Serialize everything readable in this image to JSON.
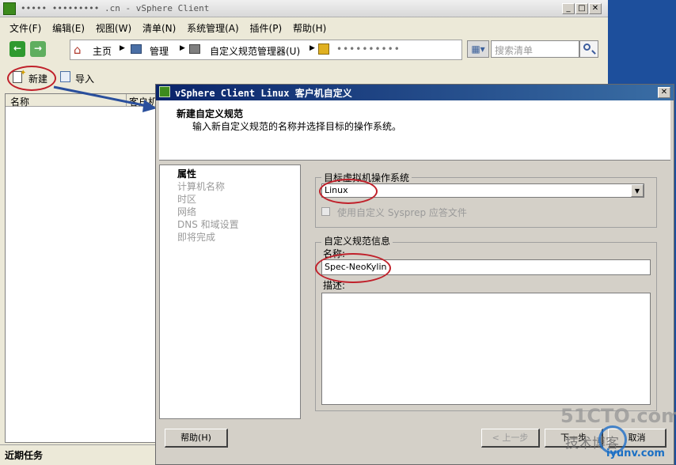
{
  "main_window": {
    "title": "••••• ••••••••• .cn - vSphere Client",
    "menu": [
      "文件(F)",
      "编辑(E)",
      "视图(W)",
      "清单(N)",
      "系统管理(A)",
      "插件(P)",
      "帮助(H)"
    ],
    "breadcrumb": {
      "home": "主页",
      "admin": "管理",
      "spec_manager": "自定义规范管理器(U)",
      "host": "••••••••••"
    },
    "search_placeholder": "搜索清单",
    "toolbar": {
      "new_label": "新建",
      "import_label": "导入"
    },
    "columns": [
      "名称",
      "客户机"
    ],
    "recent_tasks": "近期任务"
  },
  "dialog": {
    "title": "vSphere Client Linux 客户机自定义",
    "header_title": "新建自定义规范",
    "header_subtitle": "输入新自定义规范的名称并选择目标的操作系统。",
    "steps": [
      "属性",
      "计算机名称",
      "时区",
      "网络",
      "DNS 和域设置",
      "即将完成"
    ],
    "os_group_label": "目标虚拟机操作系统",
    "os_value": "Linux",
    "sysprep_label": "使用自定义 Sysprep 应答文件",
    "info_group_label": "自定义规范信息",
    "name_label": "名称:",
    "name_value": "Spec-NeoKylin",
    "desc_label": "描述:",
    "buttons": {
      "help": "帮助(H)",
      "back": "< 上一步",
      "next": "下一步",
      "cancel": "取消"
    }
  },
  "watermark": {
    "site": "51CTO.com",
    "tagline": "技术博客",
    "domain": "iyunv.com"
  }
}
